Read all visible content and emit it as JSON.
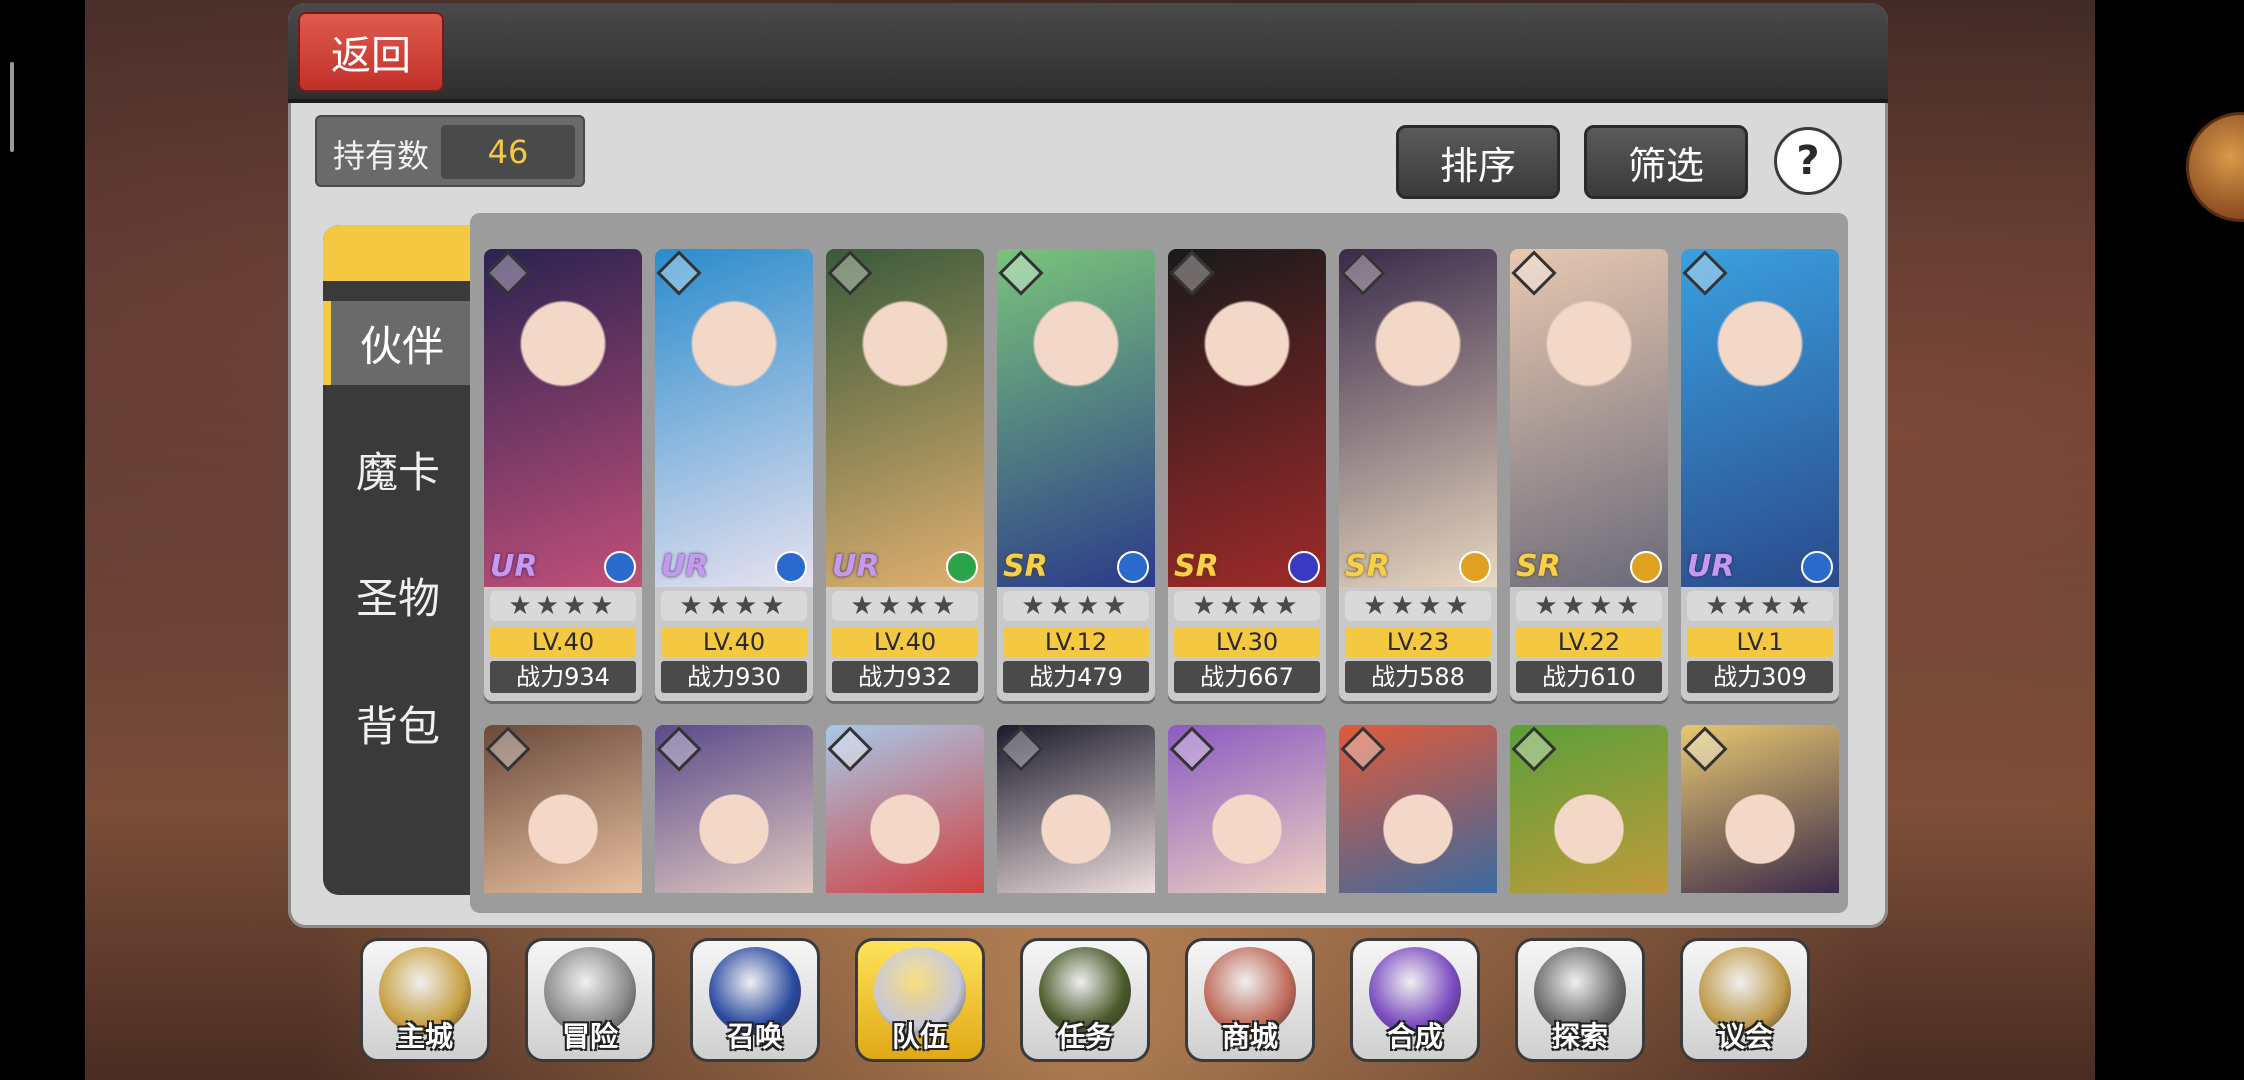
{
  "top_bar": {
    "back_label": "返回"
  },
  "owned": {
    "label": "持有数",
    "value": "46"
  },
  "toolbar": {
    "sort_label": "排序",
    "filter_label": "筛选",
    "help_label": "?"
  },
  "side_tabs": [
    {
      "label": "伙伴",
      "active": true
    },
    {
      "label": "魔卡",
      "active": false
    },
    {
      "label": "圣物",
      "active": false
    },
    {
      "label": "背包",
      "active": false
    }
  ],
  "cards_row1": [
    {
      "rarity": "UR",
      "stars": "★★★★",
      "level": "LV.40",
      "power": "战力934",
      "class_color": "#2a6acc",
      "art": [
        "#2a2250",
        "#c2507a"
      ]
    },
    {
      "rarity": "UR",
      "stars": "★★★★",
      "level": "LV.40",
      "power": "战力930",
      "class_color": "#2a6acc",
      "art": [
        "#2a8ccc",
        "#e8e2f0"
      ]
    },
    {
      "rarity": "UR",
      "stars": "★★★★",
      "level": "LV.40",
      "power": "战力932",
      "class_color": "#2aa34a",
      "art": [
        "#3a5a3a",
        "#e0b070"
      ]
    },
    {
      "rarity": "SR",
      "stars": "★★★★",
      "level": "LV.12",
      "power": "战力479",
      "class_color": "#2a6acc",
      "art": [
        "#7ac47a",
        "#2a3a8a"
      ]
    },
    {
      "rarity": "SR",
      "stars": "★★★★",
      "level": "LV.30",
      "power": "战力667",
      "class_color": "#3a3ac0",
      "art": [
        "#1a1a1a",
        "#a02a2a"
      ]
    },
    {
      "rarity": "SR",
      "stars": "★★★★",
      "level": "LV.23",
      "power": "战力588",
      "class_color": "#e0a020",
      "art": [
        "#3a2a4a",
        "#e8d8c0"
      ]
    },
    {
      "rarity": "SR",
      "stars": "★★★★",
      "level": "LV.22",
      "power": "战力610",
      "class_color": "#e0a020",
      "art": [
        "#e8c8b0",
        "#6a6a7a"
      ]
    },
    {
      "rarity": "UR",
      "stars": "★★★★",
      "level": "LV.1",
      "power": "战力309",
      "class_color": "#2a6acc",
      "art": [
        "#3aa0e0",
        "#2a4a8a"
      ]
    }
  ],
  "cards_row2": [
    {
      "art": [
        "#6a4a3a",
        "#e8c0a0"
      ]
    },
    {
      "art": [
        "#5a4a8a",
        "#e0c8c0"
      ]
    },
    {
      "art": [
        "#a8c8e8",
        "#d04040"
      ]
    },
    {
      "art": [
        "#1a1a2a",
        "#f0e0e0"
      ]
    },
    {
      "art": [
        "#8a5ac0",
        "#f0d0c0"
      ]
    },
    {
      "art": [
        "#e05a3a",
        "#3a6aa0"
      ]
    },
    {
      "art": [
        "#5aa03a",
        "#c09a3a"
      ]
    },
    {
      "art": [
        "#e8c870",
        "#3a2a4a"
      ]
    }
  ],
  "bottom_nav": [
    {
      "label": "主城",
      "icon": "castle-crown-icon",
      "active": false,
      "art": "#c8a040"
    },
    {
      "label": "冒险",
      "icon": "swords-icon",
      "active": false,
      "art": "#8a8a8a"
    },
    {
      "label": "召唤",
      "icon": "summon-card-icon",
      "active": false,
      "art": "#2a4aa0"
    },
    {
      "label": "队伍",
      "icon": "team-wings-icon",
      "active": true,
      "art": "#c8c8d8"
    },
    {
      "label": "任务",
      "icon": "quest-book-icon",
      "active": false,
      "art": "#4a5a2a"
    },
    {
      "label": "商城",
      "icon": "shop-tree-icon",
      "active": false,
      "art": "#c06a5a"
    },
    {
      "label": "合成",
      "icon": "potion-icon",
      "active": false,
      "art": "#7a4ac0"
    },
    {
      "label": "探索",
      "icon": "shovel-icon",
      "active": false,
      "art": "#6a6a6a"
    },
    {
      "label": "议会",
      "icon": "council-emblem-icon",
      "active": false,
      "art": "#c09a4a"
    }
  ]
}
